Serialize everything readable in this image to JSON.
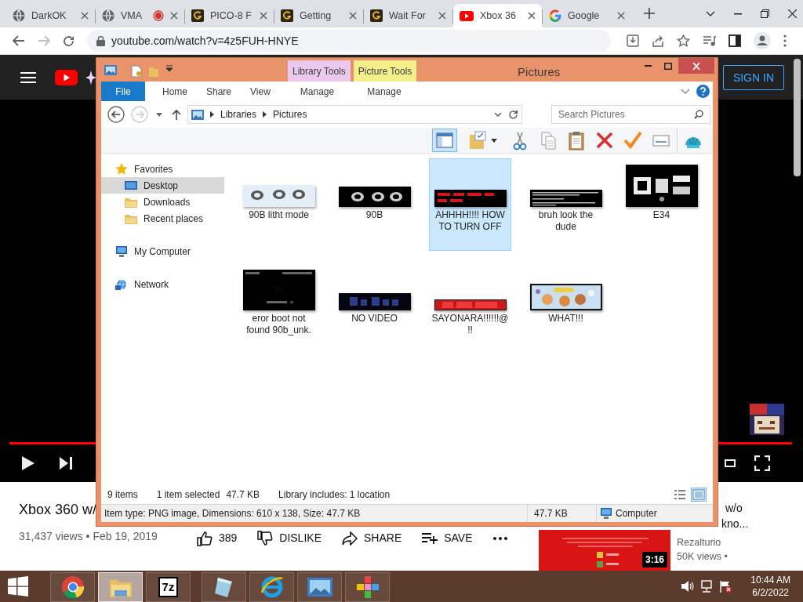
{
  "browser": {
    "tabs": [
      {
        "title": "DarkOK",
        "recording": false,
        "selected": false
      },
      {
        "title": "VMA",
        "recording": true,
        "selected": false
      },
      {
        "title": "PICO-8 F",
        "recording": false,
        "selected": false
      },
      {
        "title": "Getting",
        "recording": false,
        "selected": false
      },
      {
        "title": "Wait For",
        "recording": false,
        "selected": false
      },
      {
        "title": "Xbox 36",
        "recording": false,
        "selected": true
      },
      {
        "title": "Google",
        "recording": false,
        "selected": false
      }
    ],
    "url": "youtube.com/watch?v=4z5FUH-HNYE"
  },
  "youtube": {
    "sign_in": "SIGN IN",
    "progress": {
      "level": 1
    },
    "video_title": "Xbox 360 w/",
    "meta": "31,437 views • Feb 19, 2019",
    "actions": [
      {
        "kind": "like",
        "label": "389"
      },
      {
        "kind": "dislike",
        "label": "DISLIKE"
      },
      {
        "kind": "share",
        "label": "SHARE"
      },
      {
        "kind": "save",
        "label": "SAVE"
      },
      {
        "kind": "more"
      }
    ],
    "recommended": {
      "title_lines": [
        "w/o",
        "kno..."
      ],
      "channel": "Rezalturio",
      "views": "50K views •",
      "duration": "3:16"
    }
  },
  "explorer": {
    "title": "Pictures",
    "tool_tabs": [
      {
        "label": "Library Tools",
        "color": "#ebc9ee"
      },
      {
        "label": "Picture Tools",
        "color": "#f3f08c"
      }
    ],
    "ribbon_tabs": [
      {
        "label": "File",
        "kind": "file"
      },
      {
        "label": "Home",
        "kind": "tab"
      },
      {
        "label": "Share",
        "kind": "tab"
      },
      {
        "label": "View",
        "kind": "tab"
      },
      {
        "label": "Manage",
        "kind": "tab"
      },
      {
        "label": "Manage",
        "kind": "tab"
      }
    ],
    "breadcrumb": [
      "Libraries",
      "Pictures"
    ],
    "search": {
      "placeholder": "Search Pictures"
    },
    "toolbar": [
      {
        "kind": "preview-pane",
        "selected": true
      },
      {
        "kind": "properties",
        "selected": false
      },
      {
        "kind": "cut",
        "selected": false
      },
      {
        "kind": "copy",
        "selected": false
      },
      {
        "kind": "paste",
        "selected": false
      },
      {
        "kind": "delete",
        "selected": false
      },
      {
        "kind": "check",
        "selected": false
      },
      {
        "kind": "rename",
        "selected": false
      },
      {
        "kind": "shell",
        "selected": false
      }
    ],
    "nav": [
      {
        "label": "Favorites",
        "selected": false,
        "children": [
          {
            "label": "Desktop",
            "selected": true
          },
          {
            "label": "Downloads",
            "selected": false
          },
          {
            "label": "Recent places",
            "selected": false
          }
        ]
      },
      {
        "label": "My Computer",
        "selected": false
      },
      {
        "label": "Network",
        "selected": false
      }
    ],
    "files": [
      {
        "name": "90B litht mode",
        "selected": false
      },
      {
        "name": "90B",
        "selected": false
      },
      {
        "name": "AHHHH!!!! HOW TO TURN OFF",
        "selected": true
      },
      {
        "name": "bruh look the dude",
        "selected": false
      },
      {
        "name": "E34",
        "selected": false
      },
      {
        "name": "eror boot not found 90b_unk.",
        "selected": false
      },
      {
        "name": "NO VIDEO",
        "selected": false
      },
      {
        "name": "SAYONARA!!!!!!@!!",
        "selected": false
      },
      {
        "name": "WHAT!!!",
        "selected": false
      }
    ],
    "status": {
      "count": "9 items",
      "selection": "1 item selected",
      "selection_size": "47.7 KB",
      "library": "Library includes: 1 location",
      "views": [
        {
          "kind": "details",
          "selected": false
        },
        {
          "kind": "large-icons",
          "selected": true
        }
      ]
    },
    "details": {
      "info": "Item type: PNG image, Dimensions: 610 x 138, Size: 47.7 KB",
      "size": "47.7 KB",
      "location": "Computer"
    }
  },
  "taskbar": {
    "apps": [
      {
        "kind": "chrome",
        "selected": false
      },
      {
        "kind": "explorer",
        "selected": true
      },
      {
        "kind": "archiver",
        "label": "7z",
        "selected": false
      },
      {
        "kind": "notepad",
        "selected": false
      },
      {
        "kind": "ie",
        "selected": false
      },
      {
        "kind": "photos",
        "selected": false
      },
      {
        "kind": "paint",
        "selected": false
      }
    ],
    "time": "10:44 AM",
    "date": "6/2/2022"
  }
}
